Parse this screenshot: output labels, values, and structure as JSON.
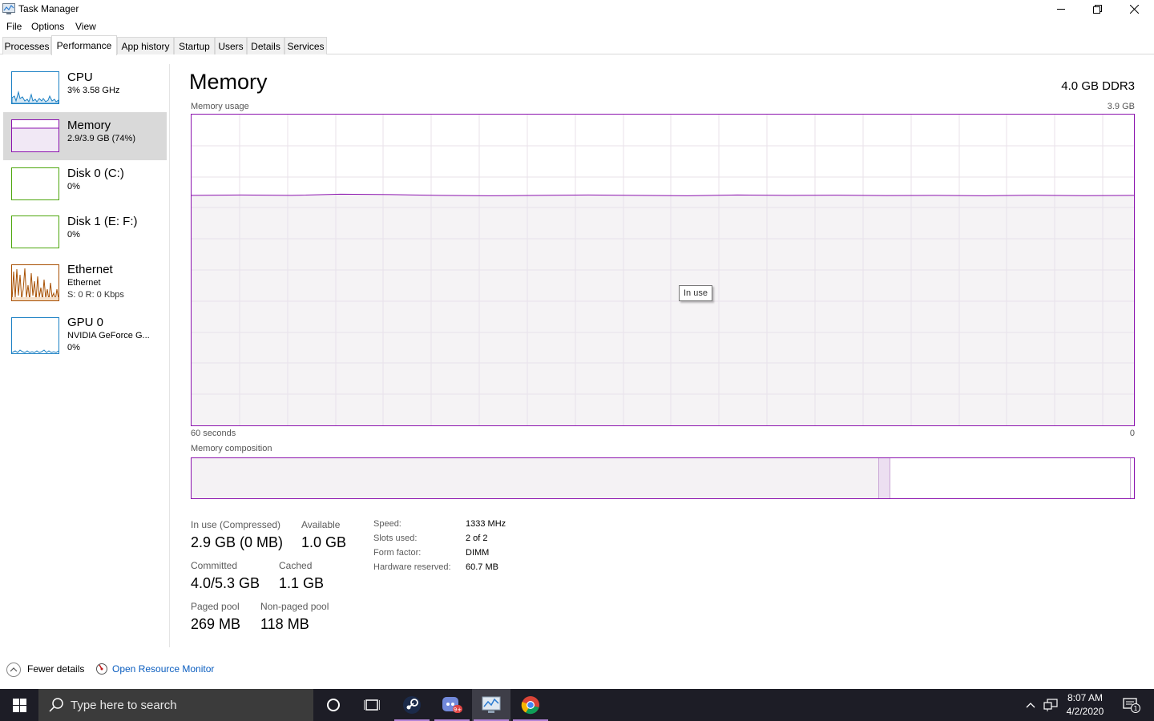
{
  "window": {
    "title": "Task Manager"
  },
  "menu": [
    "File",
    "Options",
    "View"
  ],
  "tabs": [
    "Processes",
    "Performance",
    "App history",
    "Startup",
    "Users",
    "Details",
    "Services"
  ],
  "active_tab": "Performance",
  "sidebar": {
    "items": [
      {
        "title": "CPU",
        "sub1": "3%  3.58 GHz",
        "sub2": "",
        "color": "#1b80c4"
      },
      {
        "title": "Memory",
        "sub1": "2.9/3.9 GB (74%)",
        "sub2": "",
        "color": "#8b12ae"
      },
      {
        "title": "Disk 0 (C:)",
        "sub1": "0%",
        "sub2": "",
        "color": "#4da60c"
      },
      {
        "title": "Disk 1 (E: F:)",
        "sub1": "0%",
        "sub2": "",
        "color": "#4da60c"
      },
      {
        "title": "Ethernet",
        "sub1": "Ethernet",
        "sub2": "S: 0  R: 0 Kbps",
        "color": "#a74f01"
      },
      {
        "title": "GPU 0",
        "sub1": "NVIDIA GeForce G...",
        "sub2": "0%",
        "color": "#1b80c4"
      }
    ]
  },
  "main": {
    "title": "Memory",
    "spec": "4.0 GB DDR3",
    "usage_label": "Memory usage",
    "usage_max": "3.9 GB",
    "time_label": "60 seconds",
    "time_end": "0",
    "tooltip": "In use",
    "composition_label": "Memory composition",
    "usage_level_fraction": 0.74,
    "composition_fractions": {
      "in_use": 0.73,
      "modified": 0.012,
      "standby": 0.255,
      "free": 0.003
    }
  },
  "stats": {
    "in_use_label": "In use (Compressed)",
    "in_use_value": "2.9 GB (0 MB)",
    "available_label": "Available",
    "available_value": "1.0 GB",
    "committed_label": "Committed",
    "committed_value": "4.0/5.3 GB",
    "cached_label": "Cached",
    "cached_value": "1.1 GB",
    "paged_label": "Paged pool",
    "paged_value": "269 MB",
    "nonpaged_label": "Non-paged pool",
    "nonpaged_value": "118 MB"
  },
  "properties": [
    {
      "label": "Speed:",
      "value": "1333 MHz"
    },
    {
      "label": "Slots used:",
      "value": "2 of 2"
    },
    {
      "label": "Form factor:",
      "value": "DIMM"
    },
    {
      "label": "Hardware reserved:",
      "value": "60.7 MB"
    }
  ],
  "bottom": {
    "fewer_details": "Fewer details",
    "resource_monitor": "Open Resource Monitor"
  },
  "taskbar": {
    "search_placeholder": "Type here to search",
    "time": "8:07 AM",
    "date": "4/2/2020",
    "notification_count": "1",
    "discord_badge": "9+"
  },
  "colors": {
    "memory_accent": "#8b12ae",
    "memory_fill": "#f4f2f4",
    "link": "#0a5dbf",
    "taskbar": "#1d1d26"
  }
}
